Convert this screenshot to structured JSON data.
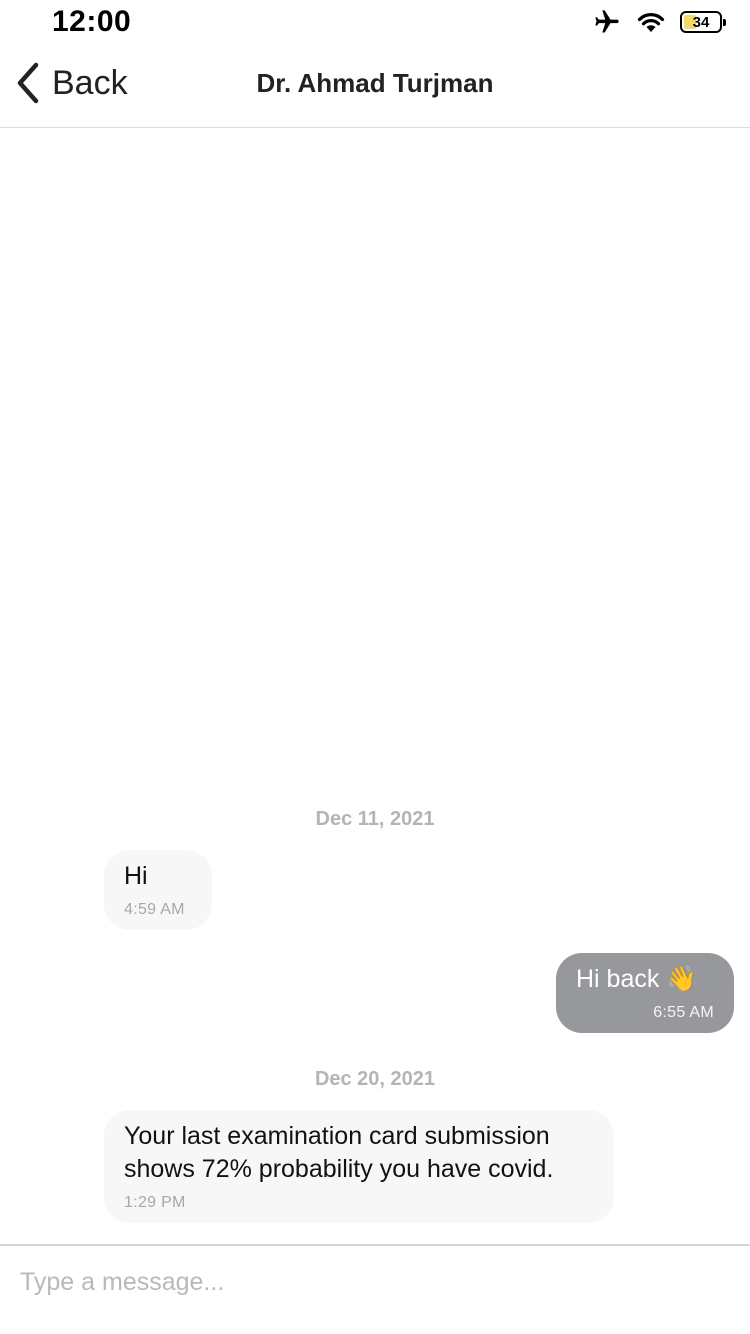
{
  "status_bar": {
    "time": "12:00",
    "battery_level": "34",
    "icons": [
      "airplane-icon",
      "wifi-icon",
      "battery-icon"
    ]
  },
  "nav": {
    "back_label": "Back",
    "title": "Dr. Ahmad Turjman"
  },
  "messages": [
    {
      "type": "date",
      "text": "Dec 11, 2021"
    },
    {
      "type": "message",
      "direction": "received",
      "text": "Hi",
      "time": "4:59 AM"
    },
    {
      "type": "message",
      "direction": "sent",
      "text": "Hi back 👋",
      "time": "6:55 AM"
    },
    {
      "type": "date",
      "text": "Dec 20, 2021"
    },
    {
      "type": "message",
      "direction": "received",
      "text": "Your last examination card submission\nshows 72% probability you have covid.",
      "time": "1:29 PM"
    }
  ],
  "composer": {
    "placeholder": "Type a message..."
  },
  "colors": {
    "sent_bubble": "#96989b",
    "received_bubble": "#f7f7f7",
    "date_text": "#b4b4b4",
    "battery_fill": "#f2d76a"
  }
}
